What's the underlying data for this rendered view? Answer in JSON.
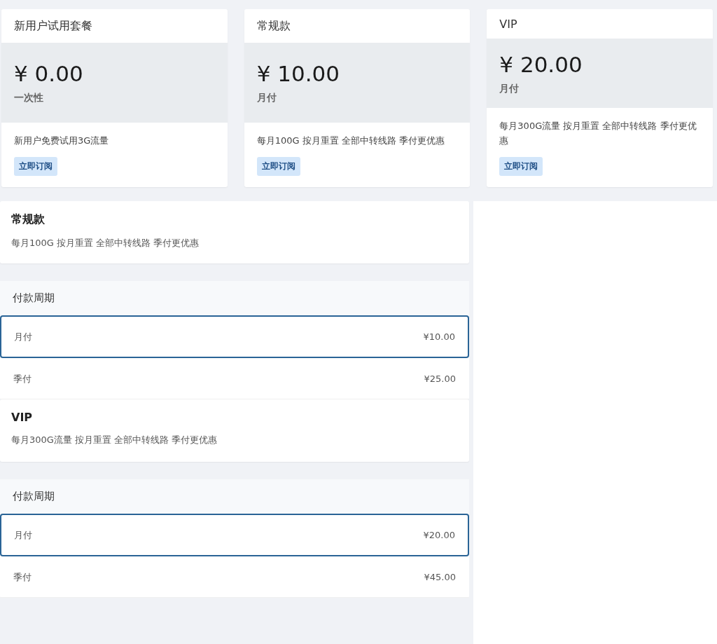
{
  "plans": [
    {
      "name": "新用户试用套餐",
      "price": "¥ 0.00",
      "cycle": "一次性",
      "description": "新用户免费试用3G流量",
      "button": "立即订阅"
    },
    {
      "name": "常规款",
      "price": "¥ 10.00",
      "cycle": "月付",
      "description": "每月100G 按月重置 全部中转线路 季付更优惠",
      "button": "立即订阅"
    },
    {
      "name": "VIP",
      "price": "¥ 20.00",
      "cycle": "月付",
      "description": "每月300G流量 按月重置 全部中转线路 季付更优惠",
      "button": "立即订阅"
    }
  ],
  "details": [
    {
      "name": "常规款",
      "description": "每月100G 按月重置 全部中转线路 季付更优惠",
      "period_title": "付款周期",
      "periods": [
        {
          "label": "月付",
          "price": "¥10.00",
          "selected": true
        },
        {
          "label": "季付",
          "price": "¥25.00",
          "selected": false
        }
      ]
    },
    {
      "name": "VIP",
      "description": "每月300G流量 按月重置 全部中转线路 季付更优惠",
      "period_title": "付款周期",
      "periods": [
        {
          "label": "月付",
          "price": "¥20.00",
          "selected": true
        },
        {
          "label": "季付",
          "price": "¥45.00",
          "selected": false
        }
      ]
    }
  ]
}
